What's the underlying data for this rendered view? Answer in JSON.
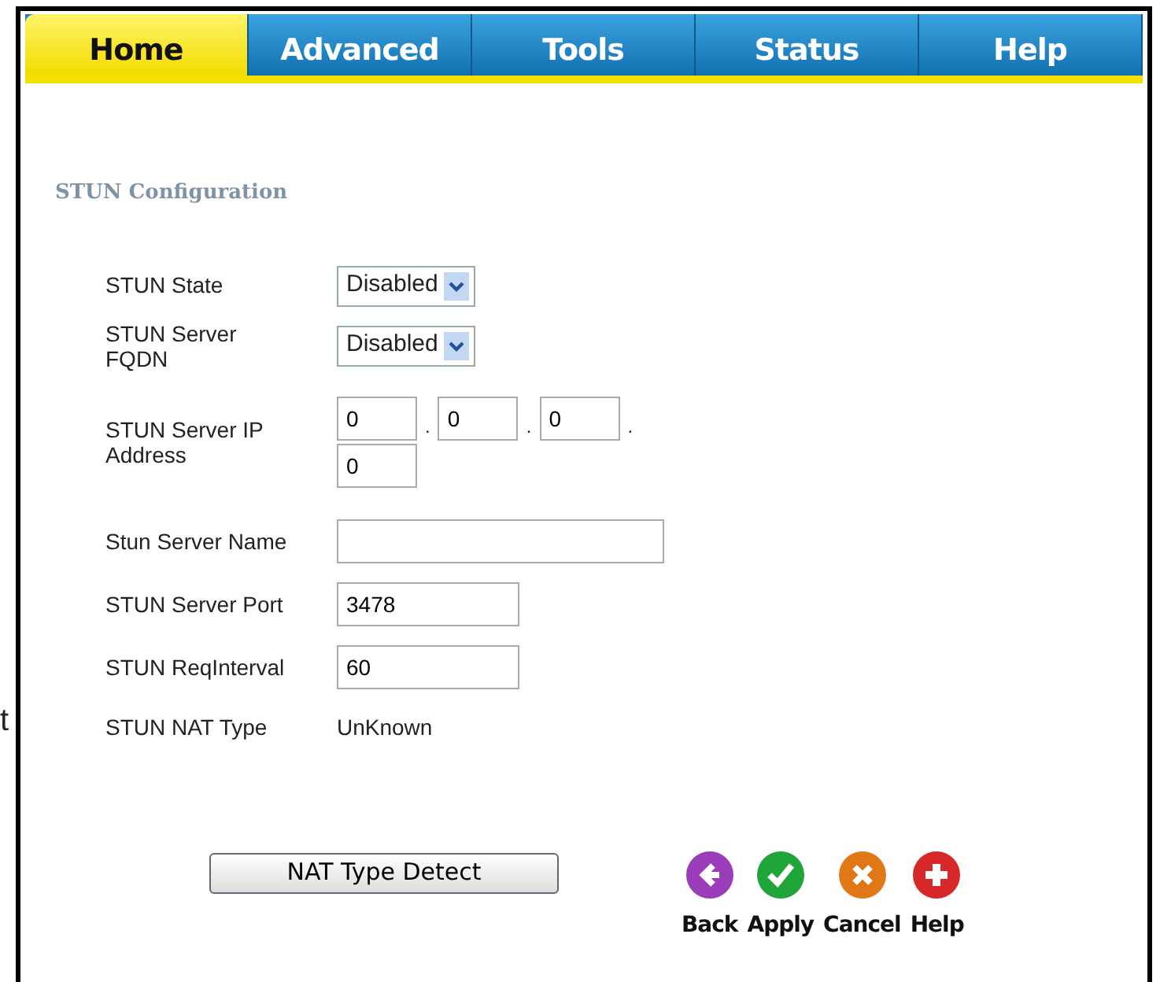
{
  "stray_text": "t",
  "tabs": [
    {
      "label": "Home",
      "selected": true
    },
    {
      "label": "Advanced",
      "selected": false
    },
    {
      "label": "Tools",
      "selected": false
    },
    {
      "label": "Status",
      "selected": false
    },
    {
      "label": "Help",
      "selected": false
    }
  ],
  "section_title": "STUN Configuration",
  "fields": [
    {
      "kind": "select",
      "label": "STUN State",
      "value": "Disabled"
    },
    {
      "kind": "select",
      "label": "STUN Server FQDN",
      "value": "Disabled"
    },
    {
      "kind": "ip",
      "label": "STUN Server IP Address",
      "octets": [
        "0",
        "0",
        "0",
        "0"
      ],
      "separators": [
        ".",
        ".",
        "."
      ]
    },
    {
      "kind": "text",
      "label": "Stun Server Name",
      "wide": true
    },
    {
      "kind": "text",
      "label": "STUN Server Port",
      "value": "3478"
    },
    {
      "kind": "text",
      "label": "STUN ReqInterval",
      "value": "60"
    },
    {
      "kind": "readonly",
      "label": "STUN NAT Type",
      "value": "UnKnown"
    }
  ],
  "detect_button": "NAT Type Detect",
  "actions": [
    {
      "kind": "back",
      "label": "Back"
    },
    {
      "kind": "apply",
      "label": "Apply"
    },
    {
      "kind": "cancel",
      "label": "Cancel"
    },
    {
      "kind": "help",
      "label": "Help"
    }
  ]
}
